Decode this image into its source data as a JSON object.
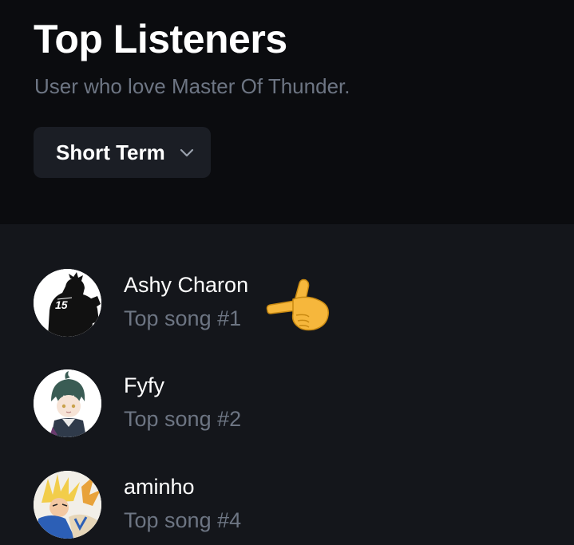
{
  "header": {
    "title": "Top Listeners",
    "subtitle": "User who love Master Of Thunder."
  },
  "range_selector": {
    "selected": "Short Term",
    "icon": "chevron-down-icon"
  },
  "listeners": [
    {
      "name": "Ashy Charon",
      "rank_label": "Top song #1"
    },
    {
      "name": "Fyfy",
      "rank_label": "Top song #2"
    },
    {
      "name": "aminho",
      "rank_label": "Top song #4"
    }
  ],
  "decoration": {
    "icon": "pointing-hand-icon"
  },
  "colors": {
    "header_bg": "#0b0c0f",
    "list_bg": "#14161b",
    "muted_text": "#6d7583",
    "dropdown_bg": "#1b1e25",
    "emoji_yellow": "#f6b73c"
  }
}
